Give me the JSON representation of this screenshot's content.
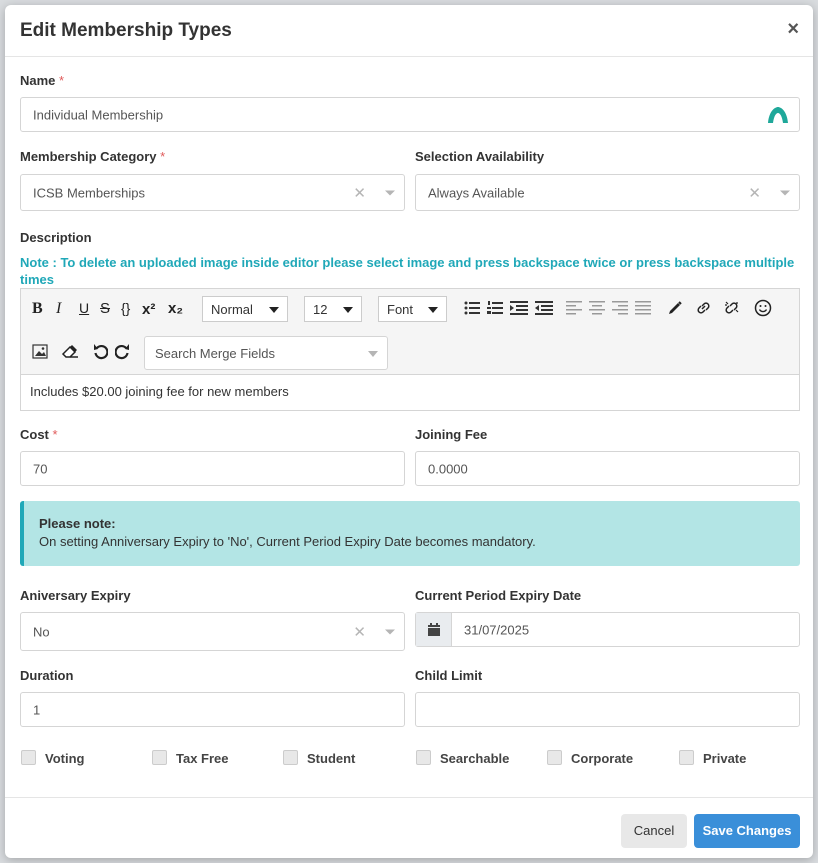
{
  "modal": {
    "title": "Edit Membership Types",
    "close_icon": "×"
  },
  "form": {
    "name_label": "Name",
    "name_value": "Individual Membership",
    "required_mark": "*",
    "category_label": "Membership Category",
    "category_value": "ICSB Memberships",
    "availability_label": "Selection Availability",
    "availability_value": "Always Available",
    "description_label": "Description",
    "description_note": "Note : To delete an uploaded image inside editor please select image and press backspace twice or press backspace multiple times",
    "cost_label": "Cost",
    "cost_value": "70",
    "joining_fee_label": "Joining Fee",
    "joining_fee_value": "0.0000",
    "anniversary_label": "Aniversary Expiry",
    "anniversary_value": "No",
    "expiry_date_label": "Current Period Expiry Date",
    "expiry_date_value": "31/07/2025",
    "duration_label": "Duration",
    "duration_value": "1",
    "child_limit_label": "Child Limit",
    "child_limit_value": ""
  },
  "editor": {
    "toolbar": {
      "bold": "B",
      "italic": "I",
      "underline": "U",
      "strike": "S",
      "code": "{}",
      "superscript": "x²",
      "subscript": "x₂",
      "style_dropdown": "Normal",
      "size_dropdown": "12",
      "font_dropdown": "Font",
      "merge_fields_placeholder": "Search Merge Fields"
    },
    "content": "Includes $20.00 joining fee for new members"
  },
  "alert": {
    "title": "Please note:",
    "body": "On setting Anniversary Expiry to 'No', Current Period Expiry Date becomes mandatory."
  },
  "checkboxes": [
    {
      "label": "Voting",
      "checked": false
    },
    {
      "label": "Tax Free",
      "checked": false
    },
    {
      "label": "Student",
      "checked": false
    },
    {
      "label": "Searchable",
      "checked": false
    },
    {
      "label": "Corporate",
      "checked": false
    },
    {
      "label": "Private",
      "checked": false
    }
  ],
  "footer": {
    "cancel_label": "Cancel",
    "save_label": "Save Changes"
  },
  "colors": {
    "accent": "#20a8b8",
    "primary_button": "#3a8fd9",
    "alert_background": "#b3e5e5",
    "required": "#e05a5a"
  },
  "icons": {
    "name_field_addon": "teal-arch-icon",
    "clear": "clear-x-icon",
    "caret": "chevron-down-icon",
    "calendar": "calendar-icon"
  }
}
